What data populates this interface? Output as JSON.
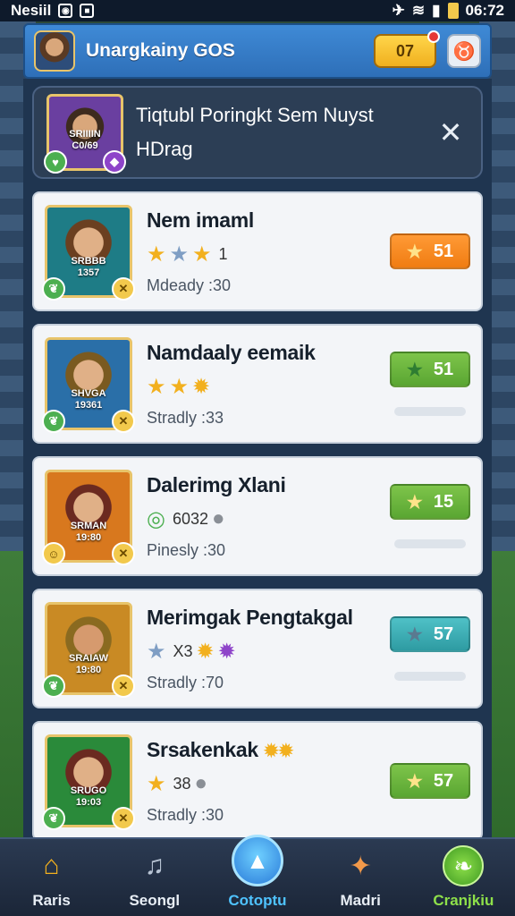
{
  "status_bar": {
    "left_text": "Nesiil",
    "time": "06:72"
  },
  "header": {
    "title": "Unargkainy GOS",
    "coins": "07"
  },
  "banner": {
    "avatar_caption": [
      "SRIIIIN",
      "C0/69"
    ],
    "text_line1": "Tiqtubl Poringkt Sem Nuyst",
    "text_line2": "HDrag"
  },
  "cards": [
    {
      "avatar_caption": [
        "SRBBB",
        "1357"
      ],
      "name": "Nem imaml",
      "stars_extra": "1",
      "sub": "Mdeady :30",
      "score": "51",
      "score_color": "#f07c12"
    },
    {
      "avatar_caption": [
        "SHVGA",
        "19361"
      ],
      "name": "Namdaaly eemaik",
      "stars_extra": "",
      "sub": "Stradly :33",
      "score": "51",
      "score_color": "#5aa632"
    },
    {
      "avatar_caption": [
        "SRMAN",
        "19:80"
      ],
      "name": "Dalerimg Xlani",
      "stars_extra": "6032",
      "sub": "Pinesly :30",
      "score": "15",
      "score_color": "#5aa632"
    },
    {
      "avatar_caption": [
        "SRAIAW",
        "19:80"
      ],
      "name": "Merimgak Pengtakgal",
      "stars_extra": "X3",
      "sub": "Stradly :70",
      "score": "57",
      "score_color": "#2e9ba2"
    },
    {
      "avatar_caption": [
        "SRUGO",
        "19:03"
      ],
      "name": "Srsakenkak",
      "stars_extra": "38",
      "sub": "Stradly :30",
      "score": "57",
      "score_color": "#5aa632"
    }
  ],
  "nav": [
    {
      "label": "Raris",
      "icon": "home-icon"
    },
    {
      "label": "Seongl",
      "icon": "music-icon"
    },
    {
      "label": "Cotoptu",
      "icon": "hat-icon"
    },
    {
      "label": "Madri",
      "icon": "items-icon"
    },
    {
      "label": "Cranjkiu",
      "icon": "leaf-icon"
    }
  ]
}
